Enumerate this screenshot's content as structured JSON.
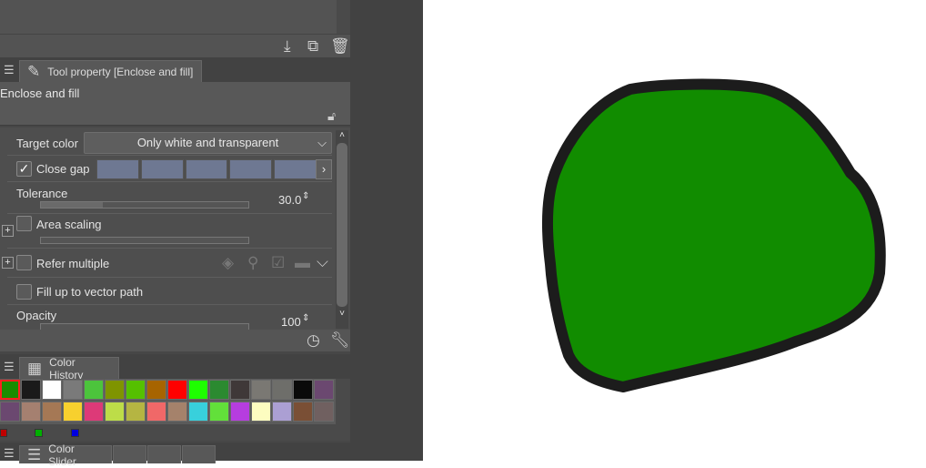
{
  "tool_property": {
    "tab_title": "Tool property [Enclose and fill]",
    "subtool_name": "Enclose and fill",
    "target_color_label": "Target color",
    "target_color_value": "Only white and transparent",
    "close_gap_label": "Close gap",
    "close_gap_checked": true,
    "tolerance_label": "Tolerance",
    "tolerance_value": "30.0",
    "area_scaling_label": "Area scaling",
    "refer_multiple_label": "Refer multiple",
    "fill_vector_label": "Fill up to vector path",
    "opacity_label": "Opacity",
    "opacity_value": "100"
  },
  "color_history": {
    "tab_title": "Color History",
    "row1": [
      "#1a8c00",
      "#1a1a1a",
      "#ffffff",
      "#7a7a7a",
      "#4cc43c",
      "#7f9400",
      "#55c000",
      "#a76400",
      "#ff0000",
      "#1eff00",
      "#2b8a30",
      "#3f3838",
      "#7a7873",
      "#6e6e6a",
      "#0a0a0a",
      "#6b4870"
    ],
    "row2": [
      "#6b4870",
      "#a58070",
      "#a57855",
      "#f7d02e",
      "#dd3a78",
      "#bddd48",
      "#b5b542",
      "#f06868",
      "#a5826b",
      "#38d0dc",
      "#62e03a",
      "#b63ddf",
      "#fdfdc0",
      "#ab9fd3",
      "#7a4f35",
      "#706060"
    ]
  },
  "color_slider": {
    "tab_title": "Color Slider"
  },
  "canvas": {
    "fill_color": "#118c00",
    "outline_color": "#1c1c1c"
  }
}
